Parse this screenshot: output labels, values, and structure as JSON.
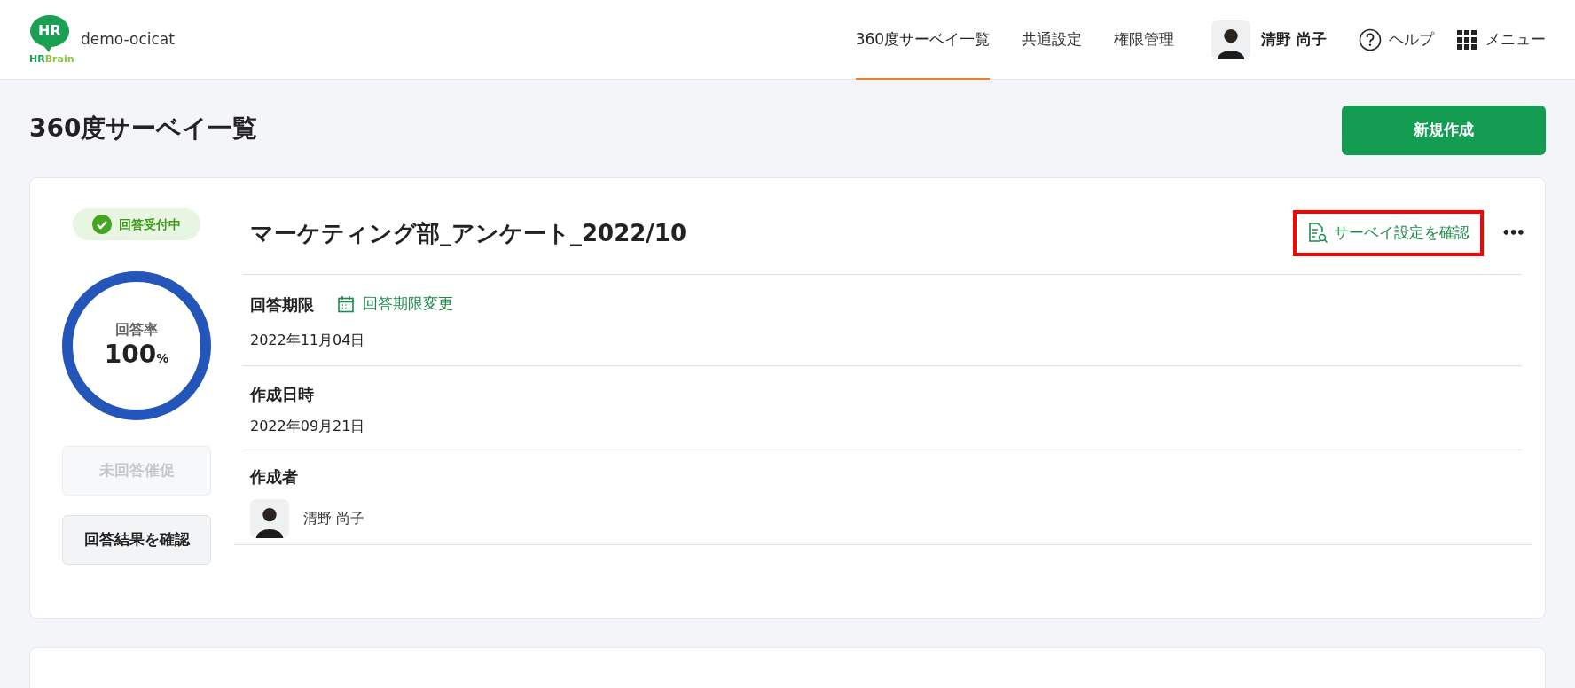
{
  "header": {
    "logo": {
      "mark": "HR",
      "wordmark_a": "HR",
      "wordmark_b": "Brain"
    },
    "tenant": "demo-ocicat",
    "nav": [
      {
        "label": "360度サーベイ一覧",
        "selected": true
      },
      {
        "label": "共通設定",
        "selected": false
      },
      {
        "label": "権限管理",
        "selected": false
      }
    ],
    "user": "清野 尚子",
    "help": "ヘルプ",
    "menu": "メニュー"
  },
  "page": {
    "title": "360度サーベイ一覧",
    "new_button": "新規作成"
  },
  "survey": {
    "status": "回答受付中",
    "title": "マーケティング部_アンケート_2022/10",
    "settings_link": {
      "label": "サーベイ設定を確認",
      "highlighted": true
    },
    "more": "•••",
    "rate": {
      "label": "回答率",
      "value": "100",
      "unit": "%",
      "level": 1
    },
    "remind_button": {
      "label": "未回答催促",
      "disabled": true
    },
    "results_button": {
      "label": "回答結果を確認",
      "disabled": false
    },
    "deadline": {
      "label": "回答期限",
      "change_link": "回答期限変更",
      "value": "2022年11月04日"
    },
    "created": {
      "label": "作成日時",
      "value": "2022年09月21日"
    },
    "creator": {
      "label": "作成者",
      "name": "清野 尚子"
    }
  }
}
